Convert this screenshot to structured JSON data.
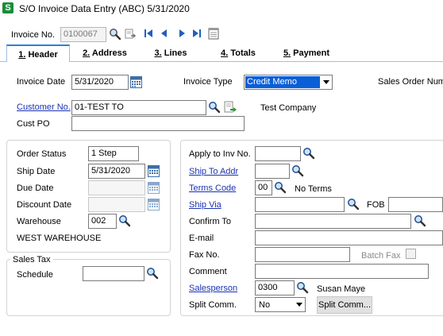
{
  "window": {
    "title": "S/O Invoice Data Entry (ABC) 5/31/2020",
    "app_icon": "sage-s-icon"
  },
  "toolbar": {
    "invoice_no_label": "Invoice No.",
    "invoice_no_value": "0100067",
    "icons": [
      "lookup-icon",
      "copy-icon",
      "first-record-icon",
      "previous-record-icon",
      "next-record-icon",
      "last-record-icon",
      "notepad-icon"
    ]
  },
  "tabs": [
    {
      "key": "1.",
      "label": " Header",
      "active": true
    },
    {
      "key": "2.",
      "label": " Address",
      "active": false
    },
    {
      "key": "3.",
      "label": " Lines",
      "active": false
    },
    {
      "key": "4.",
      "label": " Totals",
      "active": false
    },
    {
      "key": "5.",
      "label": " Payment",
      "active": false
    }
  ],
  "header": {
    "invoice_date_label": "Invoice Date",
    "invoice_date": "5/31/2020",
    "invoice_type_label": "Invoice Type",
    "invoice_type": "Credit Memo",
    "sales_order_label": "Sales Order Num",
    "customer_no_label": "Customer No.",
    "customer_no": "01-TEST TO",
    "customer_name": "Test Company",
    "cust_po_label": "Cust PO",
    "cust_po": ""
  },
  "left_panel": {
    "order_status_label": "Order Status",
    "order_status": "1 Step",
    "ship_date_label": "Ship Date",
    "ship_date": "5/31/2020",
    "due_date_label": "Due Date",
    "due_date": "",
    "discount_date_label": "Discount Date",
    "discount_date": "",
    "warehouse_label": "Warehouse",
    "warehouse": "002",
    "warehouse_name": "WEST WAREHOUSE"
  },
  "sales_tax": {
    "group_label": "Sales Tax",
    "schedule_label": "Schedule",
    "schedule": ""
  },
  "right_panel": {
    "apply_to_label": "Apply to Inv No.",
    "apply_to": "",
    "ship_to_label": "Ship To Addr",
    "ship_to": "",
    "terms_label": "Terms Code",
    "terms_code": "00",
    "terms_desc": "No Terms",
    "ship_via_label": "Ship Via",
    "ship_via": "",
    "fob_label": "FOB",
    "fob": "",
    "confirm_to_label": "Confirm To",
    "confirm_to": "",
    "email_label": "E-mail",
    "email": "",
    "fax_label": "Fax No.",
    "fax": "",
    "batch_fax_label": "Batch Fax",
    "comment_label": "Comment",
    "comment": "",
    "salesperson_label": "Salesperson",
    "salesperson": "0300",
    "salesperson_name": "Susan Maye",
    "split_comm_label": "Split Comm.",
    "split_comm": "No",
    "split_comm_button": "Split Comm..."
  },
  "colors": {
    "link": "#1a33b3",
    "selected": "#0a5fd8",
    "tab_accent": "#2f7fd5",
    "app_icon_green": "#1c8c3a"
  }
}
